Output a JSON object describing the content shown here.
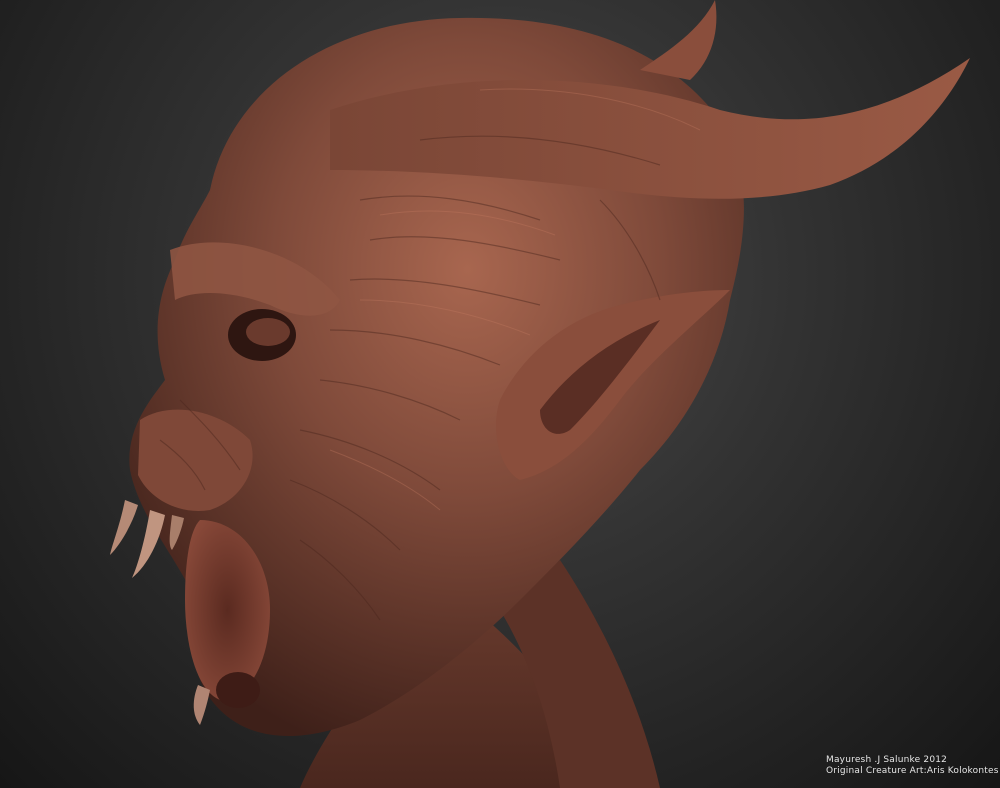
{
  "image": {
    "subject": "creature-bust-sculpt",
    "colors": {
      "background_light": "#4a4a4a",
      "background_dark": "#161616",
      "skin_base": "#7a4636",
      "skin_highlight": "#a8664f",
      "skin_shadow": "#3e2019",
      "text": "#e6e6e6"
    }
  },
  "credits": {
    "line1": "Mayuresh .J Salunke 2012",
    "line2": "Original Creature Art:Aris Kolokontes"
  }
}
